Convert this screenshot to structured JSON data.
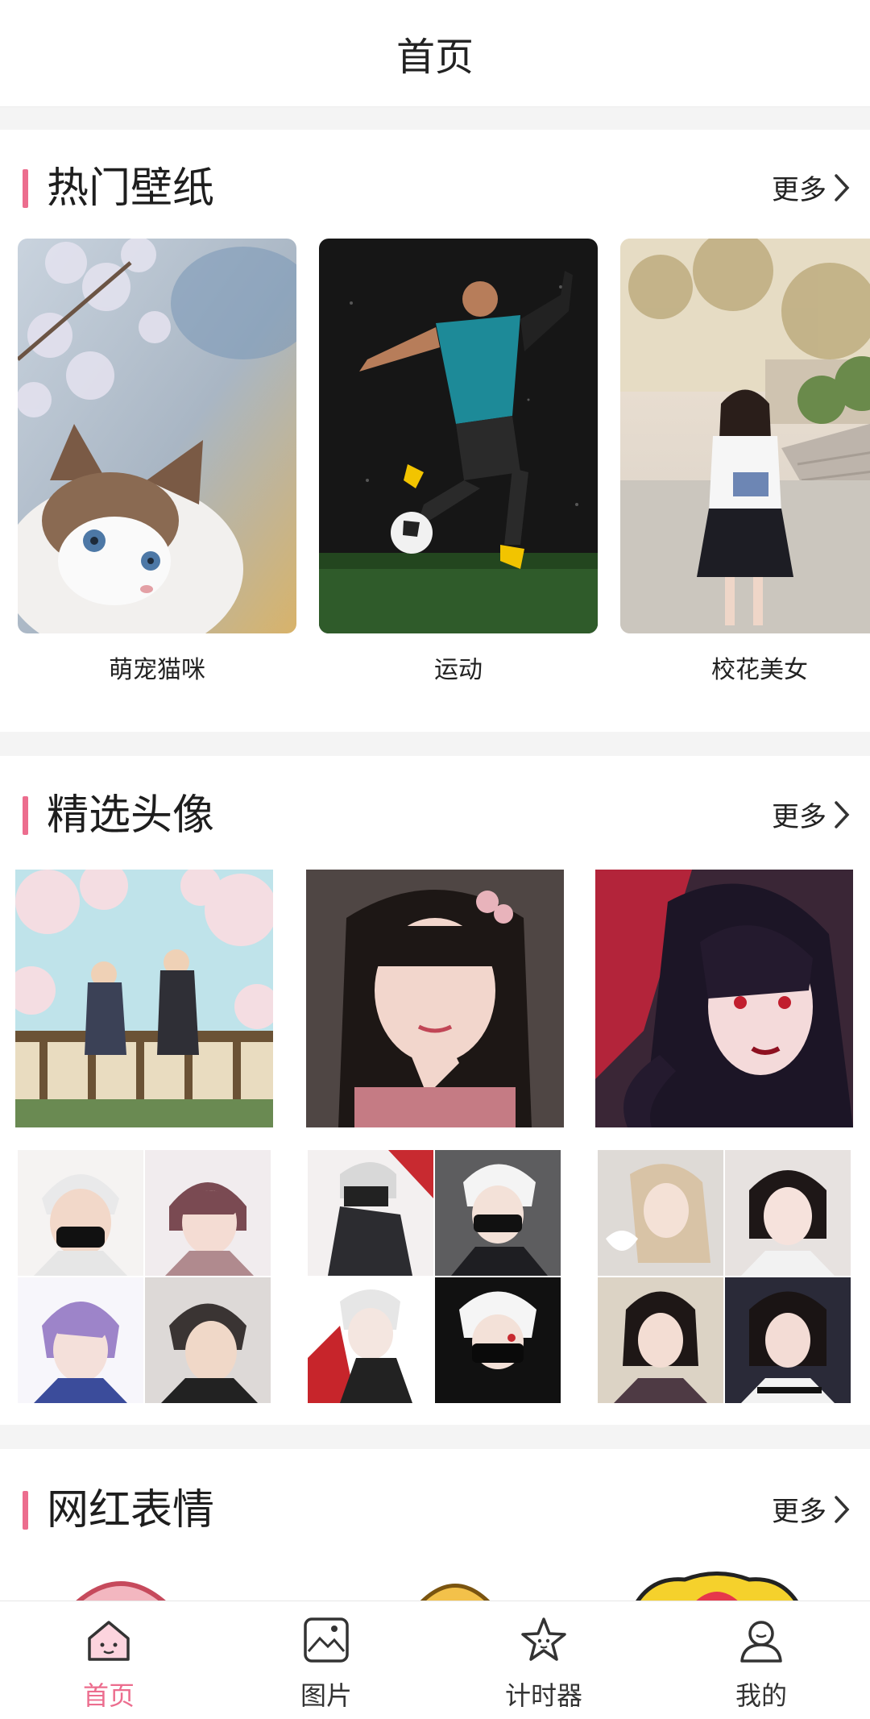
{
  "header": {
    "title": "首页"
  },
  "sections": {
    "wallpapers": {
      "title": "热门壁纸",
      "more": "更多",
      "items": [
        {
          "caption": "萌宠猫咪"
        },
        {
          "caption": "运动"
        },
        {
          "caption": "校花美女"
        }
      ]
    },
    "avatars": {
      "title": "精选头像",
      "more": "更多"
    },
    "stickers": {
      "title": "网红表情",
      "more": "更多"
    }
  },
  "nav": [
    {
      "label": "首页",
      "icon": "home-icon",
      "active": true
    },
    {
      "label": "图片",
      "icon": "image-icon",
      "active": false
    },
    {
      "label": "计时器",
      "icon": "star-timer-icon",
      "active": false
    },
    {
      "label": "我的",
      "icon": "user-icon",
      "active": false
    }
  ],
  "colors": {
    "accent": "#ec6d8e",
    "gap": "#f4f4f4"
  }
}
